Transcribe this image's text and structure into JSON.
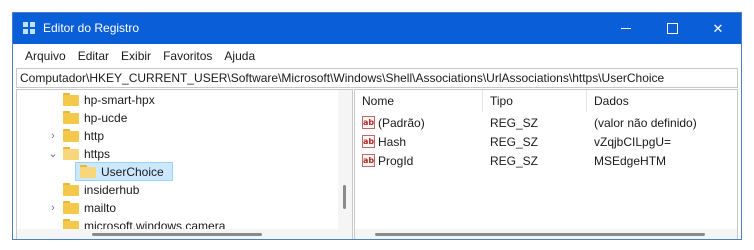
{
  "window": {
    "title": "Editor do Registro",
    "controls": {
      "minimize_icon": "minimize-icon",
      "maximize_icon": "maximize-icon",
      "close_icon": "close-icon",
      "close_glyph": "✕"
    }
  },
  "menu": {
    "items": [
      {
        "label": "Arquivo"
      },
      {
        "label": "Editar"
      },
      {
        "label": "Exibir"
      },
      {
        "label": "Favoritos"
      },
      {
        "label": "Ajuda"
      }
    ]
  },
  "address": {
    "path": "Computador\\HKEY_CURRENT_USER\\Software\\Microsoft\\Windows\\Shell\\Associations\\UrlAssociations\\https\\UserChoice"
  },
  "tree": {
    "items": [
      {
        "label": "hp-smart-hpx",
        "expander": ""
      },
      {
        "label": "hp-ucde",
        "expander": ""
      },
      {
        "label": "http",
        "expander": "›"
      },
      {
        "label": "https",
        "expander": "⌄"
      },
      {
        "label": "UserChoice",
        "expander": "",
        "selected": true
      },
      {
        "label": "insiderhub",
        "expander": ""
      },
      {
        "label": "mailto",
        "expander": "›"
      },
      {
        "label": "microsoft.windows.camera",
        "expander": ""
      }
    ]
  },
  "values": {
    "headers": {
      "name": "Nome",
      "type": "Tipo",
      "data": "Dados"
    },
    "icon_glyph": "ab",
    "rows": [
      {
        "name": "(Padrão)",
        "type": "REG_SZ",
        "data": "(valor não definido)"
      },
      {
        "name": "Hash",
        "type": "REG_SZ",
        "data": "vZqjbCILpgU="
      },
      {
        "name": "ProgId",
        "type": "REG_SZ",
        "data": "MSEdgeHTM"
      }
    ]
  },
  "colors": {
    "titlebar": "#0a5fd8",
    "selection": "#cce8ff",
    "folder": "#f4c84a"
  }
}
